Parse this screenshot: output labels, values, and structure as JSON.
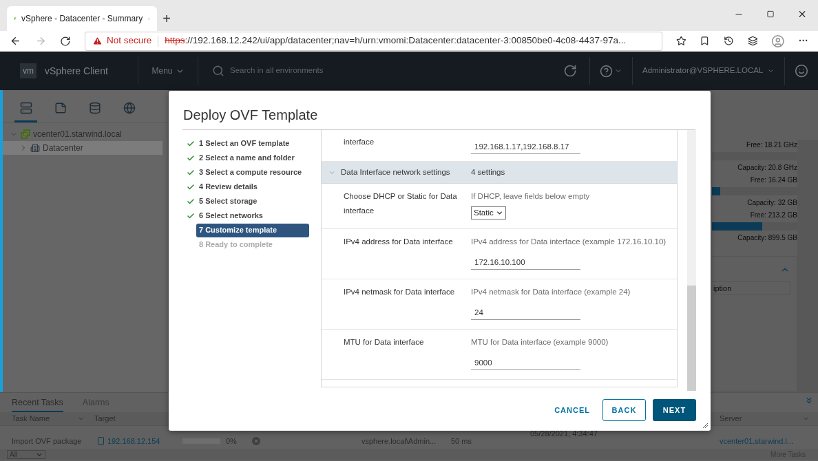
{
  "browser": {
    "tab_title": "vSphere - Datacenter - Summary",
    "new_tab": "+",
    "security": "Not secure",
    "url_scheme": "https",
    "url_rest": "://192.168.12.242/ui/app/datacenter;nav=h/urn:vmomi:Datacenter:datacenter-3:00850be0-4c08-4437-97a...",
    "more": "···"
  },
  "app_header": {
    "logo": "vm",
    "title": "vSphere Client",
    "menu": "Menu",
    "search_placeholder": "Search in all environments",
    "user": "Administrator@VSPHERE.LOCAL"
  },
  "sidebar": {
    "tabs": [
      {
        "kind": "hosts",
        "selected": true
      },
      {
        "kind": "vms",
        "selected": false
      },
      {
        "kind": "storage",
        "selected": false
      },
      {
        "kind": "network",
        "selected": false
      }
    ],
    "tree": [
      {
        "label": "vcenter01.starwind.local",
        "kind": "vcenter",
        "expanded": true,
        "selected": false,
        "children": [
          {
            "label": "Datacenter",
            "kind": "datacenter",
            "expanded": false,
            "selected": true
          }
        ]
      }
    ]
  },
  "summary": {
    "resources": [
      {
        "free": "Free: 18.21 GHz",
        "capacity": "Capacity: 20.8 GHz"
      },
      {
        "free": "Free: 16.24 GB",
        "level": 0.1,
        "capacity": "Capacity: 32 GB"
      },
      {
        "free": "Free: 213.2 GB",
        "level": 0.59,
        "capacity": "Capacity: 899.5 GB"
      }
    ],
    "table_header": "iption"
  },
  "tasks_panel": {
    "tabs": [
      {
        "label": "Recent Tasks",
        "selected": true
      },
      {
        "label": "Alarms",
        "selected": false
      }
    ],
    "columns": [
      "Task Name",
      "Target",
      "Server"
    ],
    "rows": [
      {
        "task": "Import OVF package",
        "target": "192.168.12.154",
        "column_3": {
          "reading": "0%"
        },
        "column_4": "vsphere.local\\Admin...",
        "column_5": "50 ms",
        "column_6": "05/28/2021, 4:34:47",
        "server": "vcenter01.starwind.l..."
      }
    ],
    "filter": "All",
    "more": "More Tasks"
  },
  "dialog": {
    "title": "Deploy OVF Template",
    "steps": [
      {
        "label": "1 Select an OVF template",
        "done": true,
        "selected": false
      },
      {
        "label": "2 Select a name and folder",
        "done": true,
        "selected": false
      },
      {
        "label": "3 Select a compute resource",
        "done": true,
        "selected": false
      },
      {
        "label": "4 Review details",
        "done": true,
        "selected": false
      },
      {
        "label": "5 Select storage",
        "done": true,
        "selected": false
      },
      {
        "label": "6 Select networks",
        "done": true,
        "selected": false
      },
      {
        "label": "7 Customize template",
        "done": false,
        "selected": true
      },
      {
        "label": "8 Ready to complete",
        "done": false,
        "selected": false
      }
    ],
    "settings": [
      {
        "kind": "field",
        "label": "interface",
        "value": "192.168.1.17,192.168.8.17"
      },
      {
        "kind": "group",
        "label": "Data Interface network settings",
        "summary": "4 settings",
        "expanded": true
      },
      {
        "kind": "select",
        "label": "Choose DHCP or Static for Data interface",
        "description": "If DHCP, leave fields below empty",
        "value": "Static"
      },
      {
        "kind": "field",
        "label": "IPv4 address for Data interface",
        "description": "IPv4 address for Data interface (example 172.16.10.10)",
        "value": "172.16.10.100"
      },
      {
        "kind": "field",
        "label": "IPv4 netmask for Data interface",
        "description": "IPv4 netmask for Data interface (example 24)",
        "value": "24"
      },
      {
        "kind": "field",
        "label": "MTU for Data interface",
        "description": "MTU for Data interface (example 9000)",
        "value": "9000"
      }
    ],
    "buttons": [
      {
        "label": "CANCEL",
        "kind": "link"
      },
      {
        "label": "BACK",
        "kind": "outline"
      },
      {
        "label": "NEXT",
        "kind": "primary"
      }
    ]
  }
}
